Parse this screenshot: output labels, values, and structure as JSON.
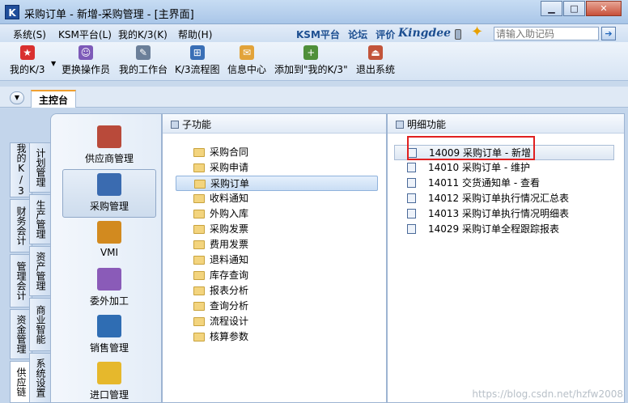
{
  "window": {
    "title": "采购订单 - 新增-采购管理 - [主界面]",
    "app_icon_glyph": "K",
    "minimize_glyph": "▁",
    "maximize_glyph": "□",
    "close_glyph": "✕"
  },
  "menubar": {
    "items": [
      "系统(S)",
      "KSM平台(L)",
      "我的K/3(K)",
      "帮助(H)"
    ],
    "brand_links": [
      "KSM平台",
      "论坛",
      "评价"
    ],
    "brand": "Kingdee",
    "search_placeholder": "请输入助记码",
    "search_go_glyph": "➔"
  },
  "toolbar": {
    "buttons": [
      {
        "label": "我的K/3",
        "icon": "star-icon",
        "color": "#d9302f"
      },
      {
        "label": "更换操作员",
        "icon": "users-icon",
        "color": "#7d5ab8"
      },
      {
        "label": "我的工作台",
        "icon": "pencil-icon",
        "color": "#6b7f99"
      },
      {
        "label": "K/3流程图",
        "icon": "flowchart-icon",
        "color": "#3a6fb6"
      },
      {
        "label": "信息中心",
        "icon": "message-icon",
        "color": "#e2a33a"
      },
      {
        "label": "添加到\"我的K/3\"",
        "icon": "add-favorite-icon",
        "color": "#4f8f3a"
      },
      {
        "label": "退出系统",
        "icon": "exit-icon",
        "color": "#c2543a"
      }
    ]
  },
  "tabs": {
    "arrow_glyph": "▼",
    "main": "主控台"
  },
  "vertical_tabs": {
    "left": [
      "我的K/3",
      "财务会计",
      "管理会计",
      "资金管理",
      "供应链"
    ],
    "right": [
      "计划管理",
      "生产管理",
      "资产管理",
      "商业智能",
      "系统设置"
    ]
  },
  "modules": [
    {
      "label": "供应商管理",
      "icon": "supplier-icon",
      "color": "#b94a3a"
    },
    {
      "label": "采购管理",
      "icon": "purchase-icon",
      "color": "#3a6bb0"
    },
    {
      "label": "VMI",
      "icon": "vmi-icon",
      "color": "#d28a1f"
    },
    {
      "label": "委外加工",
      "icon": "outsourcing-icon",
      "color": "#8a5bb8"
    },
    {
      "label": "销售管理",
      "icon": "sales-truck-icon",
      "color": "#2f6db3"
    },
    {
      "label": "进口管理",
      "icon": "import-icon",
      "color": "#e6b82c"
    }
  ],
  "sub_panel": {
    "heading": "子功能",
    "items": [
      "采购合同",
      "采购申请",
      "采购订单",
      "收料通知",
      "外购入库",
      "采购发票",
      "费用发票",
      "退料通知",
      "库存查询",
      "报表分析",
      "查询分析",
      "流程设计",
      "核算参数"
    ],
    "selected": "采购订单"
  },
  "detail_panel": {
    "heading": "明细功能",
    "items": [
      {
        "code": "14009",
        "name": "采购订单 - 新增"
      },
      {
        "code": "14010",
        "name": "采购订单 - 维护"
      },
      {
        "code": "14011",
        "name": "交货通知单 - 查看"
      },
      {
        "code": "14012",
        "name": "采购订单执行情况汇总表"
      },
      {
        "code": "14013",
        "name": "采购订单执行情况明细表"
      },
      {
        "code": "14029",
        "name": "采购订单全程跟踪报表"
      }
    ]
  },
  "watermark": "https://blog.csdn.net/hzfw2008"
}
